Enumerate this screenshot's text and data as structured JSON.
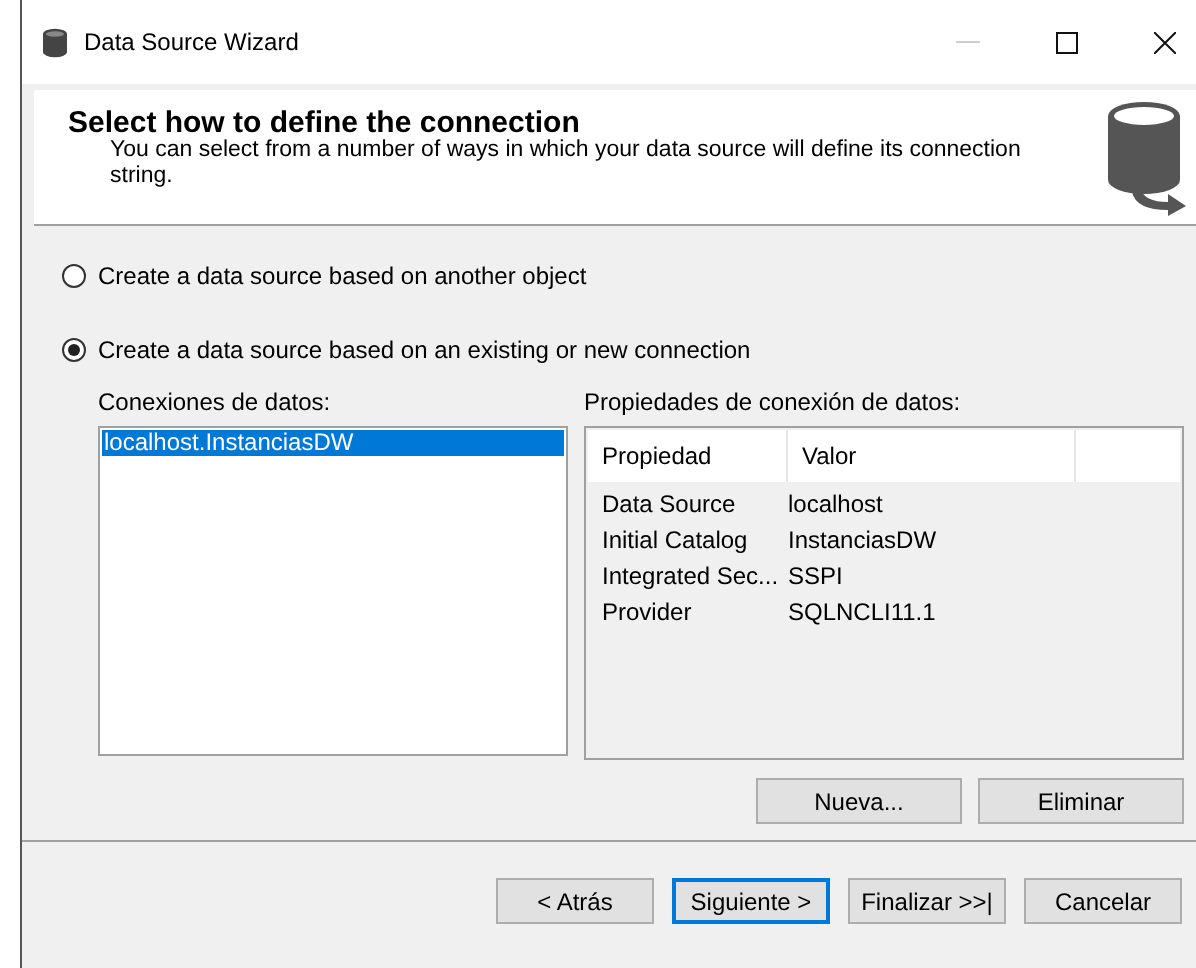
{
  "window": {
    "title": "Data Source Wizard"
  },
  "header": {
    "title": "Select how to define the connection",
    "description": "You can select from a number of ways in which your data source will define its connection string."
  },
  "options": [
    {
      "label": "Create a data source based on another object",
      "selected": false
    },
    {
      "label": "Create a data source based on an existing or new connection",
      "selected": true
    }
  ],
  "connections": {
    "label": "Conexiones de datos:",
    "items": [
      {
        "label": "localhost.InstanciasDW",
        "selected": true
      }
    ]
  },
  "properties": {
    "label": "Propiedades de conexión de datos:",
    "columns": [
      "Propiedad",
      "Valor"
    ],
    "rows": [
      [
        "Data Source",
        "localhost"
      ],
      [
        "Initial Catalog",
        "InstanciasDW"
      ],
      [
        "Integrated Sec...",
        "SSPI"
      ],
      [
        "Provider",
        "SQLNCLI11.1"
      ]
    ]
  },
  "connection_buttons": [
    "Nueva...",
    "Eliminar"
  ],
  "footer_buttons": [
    {
      "label": "< Atrás",
      "default": false
    },
    {
      "label": "Siguiente >",
      "default": true
    },
    {
      "label": "Finalizar >>|",
      "default": false
    },
    {
      "label": "Cancelar",
      "default": false
    }
  ]
}
